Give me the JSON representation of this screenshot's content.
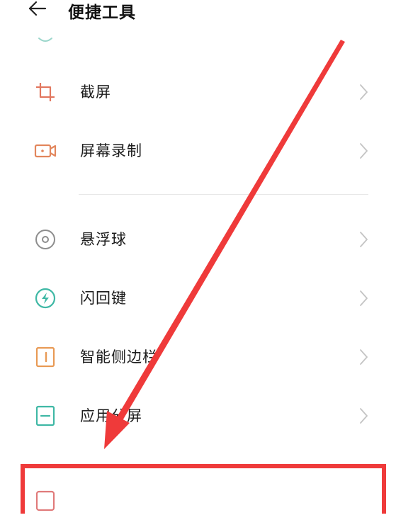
{
  "header": {
    "title": "便捷工具",
    "back_icon": "arrow-left-icon"
  },
  "menu": {
    "items": [
      {
        "label": "截屏",
        "icon": "crop-screenshot-icon",
        "icon_color": "#e2775f"
      },
      {
        "label": "屏幕录制",
        "icon": "video-record-icon",
        "icon_color": "#e2865c"
      },
      {
        "label": "悬浮球",
        "icon": "floating-ball-icon",
        "icon_color": "#8d8d8d"
      },
      {
        "label": "闪回键",
        "icon": "lightning-icon",
        "icon_color": "#3fb8a5"
      },
      {
        "label": "智能侧边栏",
        "icon": "sidebar-icon",
        "icon_color": "#e89a55"
      },
      {
        "label": "应用分屏",
        "icon": "split-screen-icon",
        "icon_color": "#3fb8a5"
      },
      {
        "label": "",
        "icon": "partial-icon",
        "icon_color": "#e07a7a"
      }
    ]
  },
  "colors": {
    "highlight": "#ef3a3a",
    "divider": "#e8e8e8",
    "chevron": "#c4c4c4"
  }
}
